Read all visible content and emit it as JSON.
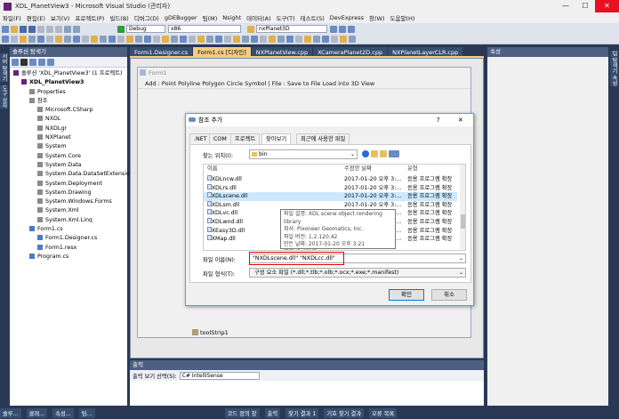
{
  "window": {
    "title": "XDL_PlanetView3 - Microsoft Visual Studio (관리자)",
    "min": "—",
    "max": "☐",
    "close": "✕"
  },
  "menu": [
    "파일(F)",
    "편집(E)",
    "보기(V)",
    "프로젝트(P)",
    "빌드(B)",
    "디버그(D)",
    "gDEBugger",
    "팀(M)",
    "Nsight",
    "데이터(A)",
    "도구(T)",
    "테스트(S)",
    "DevExpress",
    "창(W)",
    "도움말(H)"
  ],
  "toolbar": {
    "config": "Debug",
    "platform": "x86",
    "project": "nxPlanet3D"
  },
  "solution": {
    "title": "솔루션 탐색기",
    "items": [
      {
        "t": "솔루션 'XDL_PlanetView3' (1 프로젝트)",
        "i": 0
      },
      {
        "t": "XDL_PlanetView3",
        "i": 1,
        "bold": true
      },
      {
        "t": "Properties",
        "i": 2
      },
      {
        "t": "참조",
        "i": 2
      },
      {
        "t": "Microsoft.CSharp",
        "i": 3
      },
      {
        "t": "NXDL",
        "i": 3
      },
      {
        "t": "NXDLgr",
        "i": 3
      },
      {
        "t": "NXPlanet",
        "i": 3
      },
      {
        "t": "System",
        "i": 3
      },
      {
        "t": "System.Core",
        "i": 3
      },
      {
        "t": "System.Data",
        "i": 3
      },
      {
        "t": "System.Data.DataSetExtensions",
        "i": 3
      },
      {
        "t": "System.Deployment",
        "i": 3
      },
      {
        "t": "System.Drawing",
        "i": 3
      },
      {
        "t": "System.Windows.Forms",
        "i": 3
      },
      {
        "t": "System.Xml",
        "i": 3
      },
      {
        "t": "System.Xml.Linq",
        "i": 3
      },
      {
        "t": "Form1.cs",
        "i": 2
      },
      {
        "t": "Form1.Designer.cs",
        "i": 3
      },
      {
        "t": "Form1.resx",
        "i": 3
      },
      {
        "t": "Program.cs",
        "i": 2
      }
    ]
  },
  "leftstrip": [
    "서버 탐색기",
    "도구 상자"
  ],
  "tabs": [
    "Form1.Designer.cs",
    "Form1.cs [디자인]",
    "NXPlanetView.cpp",
    "XCameraPlanet2D.cpp",
    "NXPlanetLayerCLR.cpp"
  ],
  "form": {
    "title": "Form1",
    "menu": "Add :  Point  Polyline  Polygon  Circle  Symbol  |  File :  Save to File  Load into 3D View",
    "toolstrip": "toolStrip1"
  },
  "props": {
    "title": "속성",
    "vtab": "팀 탐색기 속성"
  },
  "dialog": {
    "title": "참조 추가",
    "help": "?",
    "close": "✕",
    "tabs": [
      ".NET",
      "COM",
      "프로젝트",
      "찾아보기",
      "최근에 사용한 파일"
    ],
    "lookin_label": "찾는 위치(I):",
    "lookin_value": "bin",
    "cols": [
      "이름",
      "수정한 날짜",
      "유형"
    ],
    "files": [
      {
        "n": "NXDLncw.dll",
        "d": "2017-01-20 오후 3:...",
        "t": "응용 프로그램 확장"
      },
      {
        "n": "NXDLrs.dll",
        "d": "2017-01-20 오후 3:...",
        "t": "응용 프로그램 확장"
      },
      {
        "n": "NXDLscene.dll",
        "d": "2017-01-20 오후 3:...",
        "t": "응용 프로그램 확장",
        "sel": true
      },
      {
        "n": "NXDLsm.dll",
        "d": "2017-01-20 오후 3:...",
        "t": "응용 프로그램 확장"
      },
      {
        "n": "NXDLvc.dll",
        "d": "2017-01-20 오후 3:...",
        "t": "응용 프로그램 확장"
      },
      {
        "n": "NXDLwnd.dll",
        "d": "2017-01-20 오후 3:...",
        "t": "응용 프로그램 확장"
      },
      {
        "n": "NXEasy3D.dll",
        "d": "2017-01-20 오후 3:...",
        "t": "응용 프로그램 확장"
      },
      {
        "n": "NXMap.dll",
        "d": "2017-01-20 오후 3:...",
        "t": "응용 프로그램 확장"
      }
    ],
    "tooltip": [
      "파일 설명: XDL scene object rendering library",
      "회사: Pixoneer Geomatics, Inc.",
      "파일 버전: 1.2.120.42",
      "만든 날짜: 2017-01-20 오후 3:21",
      "크기: 3.40MB"
    ],
    "filename_label": "파일 이름(N):",
    "filename_value": "\"NXDLscene.dll\" \"NXDLcc.dll\"",
    "filetype_label": "파일 형식(T):",
    "filetype_value": "구성 요소 파일 (*.dll;*.tlb;*.olb;*.ocx;*.exe;*.manifest)",
    "ok": "확인",
    "cancel": "취소"
  },
  "output": {
    "title": "출력",
    "source_label": "출력 보기 선택(S):",
    "source_value": "C# IntelliSense"
  },
  "status": [
    "솔루...",
    "클래...",
    "속성...",
    "팀...",
    "코드 정의 창",
    "출력",
    "찾기 결과 1",
    "기호 찾기 결과",
    "오류 목록"
  ],
  "colors": {
    "frame": "#293955",
    "accent": "#f5cc84",
    "selection": "#cce8ff",
    "highlight": "#e00000"
  }
}
